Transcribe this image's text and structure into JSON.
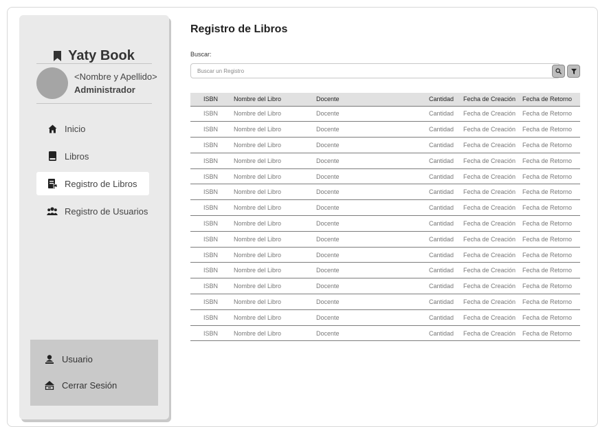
{
  "app": {
    "brand": "Yaty Book"
  },
  "user": {
    "name": "<Nombre y Apellido>",
    "role": "Administrador"
  },
  "nav": [
    {
      "label": "Inicio",
      "icon": "home-icon"
    },
    {
      "label": "Libros",
      "icon": "book-icon"
    },
    {
      "label": "Registro de Libros",
      "icon": "book-register-icon",
      "active": true
    },
    {
      "label": "Registro de Usuarios",
      "icon": "users-icon"
    }
  ],
  "bottom": {
    "user_label": "Usuario",
    "logout_label": "Cerrar Sesión"
  },
  "page": {
    "title": "Registro de Libros"
  },
  "search": {
    "label": "Buscar:",
    "placeholder": "Buscar un Registro"
  },
  "table": {
    "headers": [
      "ISBN",
      "Nombre del Libro",
      "Docente",
      "Cantidad",
      "Fecha de Creación",
      "Fecha de Retorno"
    ],
    "rows": [
      [
        "ISBN",
        "Nombre del Libro",
        "Docente",
        "Cantidad",
        "Fecha de Creación",
        "Fecha de Retorno"
      ],
      [
        "ISBN",
        "Nombre del Libro",
        "Docente",
        "Cantidad",
        "Fecha de Creación",
        "Fecha de Retorno"
      ],
      [
        "ISBN",
        "Nombre del Libro",
        "Docente",
        "Cantidad",
        "Fecha de Creación",
        "Fecha de Retorno"
      ],
      [
        "ISBN",
        "Nombre del Libro",
        "Docente",
        "Cantidad",
        "Fecha de Creación",
        "Fecha de Retorno"
      ],
      [
        "ISBN",
        "Nombre del Libro",
        "Docente",
        "Cantidad",
        "Fecha de Creación",
        "Fecha de Retorno"
      ],
      [
        "ISBN",
        "Nombre del Libro",
        "Docente",
        "Cantidad",
        "Fecha de Creación",
        "Fecha de Retorno"
      ],
      [
        "ISBN",
        "Nombre del Libro",
        "Docente",
        "Cantidad",
        "Fecha de Creación",
        "Fecha de Retorno"
      ],
      [
        "ISBN",
        "Nombre del Libro",
        "Docente",
        "Cantidad",
        "Fecha de Creación",
        "Fecha de Retorno"
      ],
      [
        "ISBN",
        "Nombre del Libro",
        "Docente",
        "Cantidad",
        "Fecha de Creación",
        "Fecha de Retorno"
      ],
      [
        "ISBN",
        "Nombre del Libro",
        "Docente",
        "Cantidad",
        "Fecha de Creación",
        "Fecha de Retorno"
      ],
      [
        "ISBN",
        "Nombre del Libro",
        "Docente",
        "Cantidad",
        "Fecha de Creación",
        "Fecha de Retorno"
      ],
      [
        "ISBN",
        "Nombre del Libro",
        "Docente",
        "Cantidad",
        "Fecha de Creación",
        "Fecha de Retorno"
      ],
      [
        "ISBN",
        "Nombre del Libro",
        "Docente",
        "Cantidad",
        "Fecha de Creación",
        "Fecha de Retorno"
      ],
      [
        "ISBN",
        "Nombre del Libro",
        "Docente",
        "Cantidad",
        "Fecha de Creación",
        "Fecha de Retorno"
      ],
      [
        "ISBN",
        "Nombre del Libro",
        "Docente",
        "Cantidad",
        "Fecha de Creación",
        "Fecha de Retorno"
      ]
    ]
  },
  "icons": {
    "search": "search-icon",
    "filter": "filter-icon",
    "bookmark": "bookmark-icon",
    "user": "user-icon",
    "logout": "logout-icon"
  },
  "colors": {
    "sidebar_bg": "#eaeaea",
    "active_item_bg": "#ffffff",
    "bottom_box_bg": "#c9c9c9",
    "table_header_bg": "#e1e1e1"
  }
}
